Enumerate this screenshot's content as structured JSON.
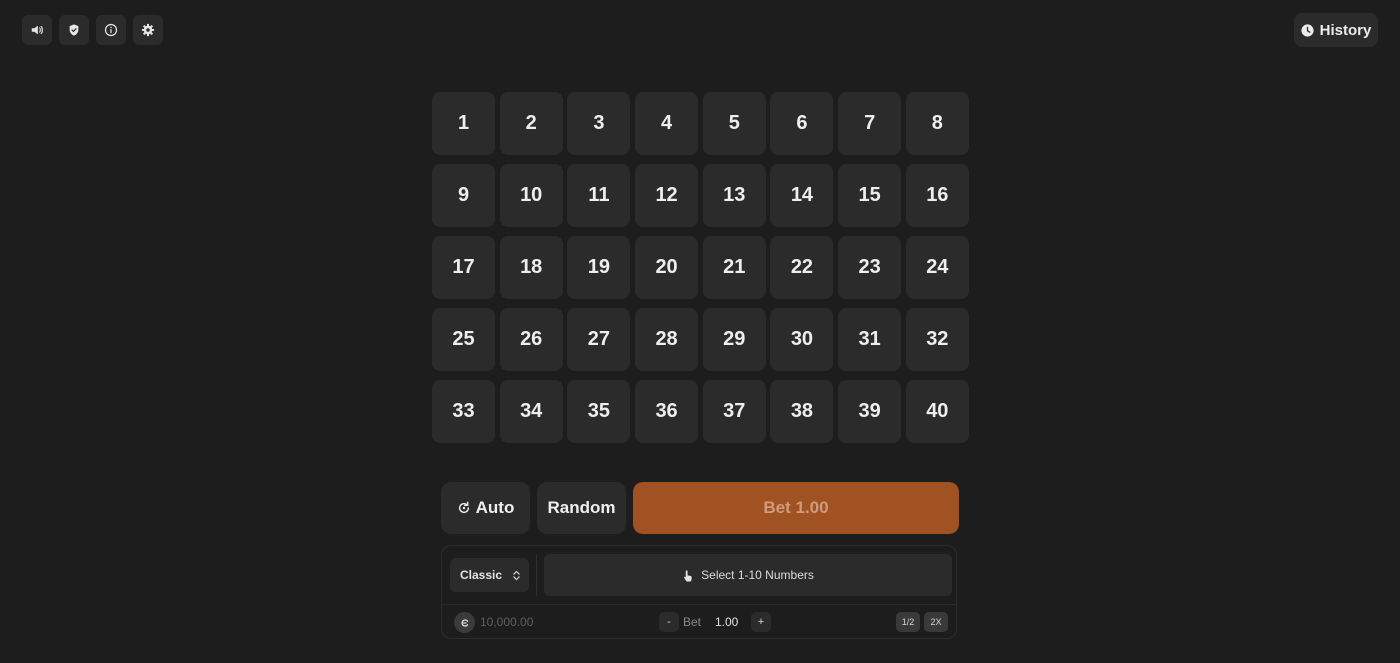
{
  "top_bar": {
    "icons": [
      "volume-icon",
      "shield-icon",
      "info-icon",
      "settings-icon"
    ],
    "history_label": "History"
  },
  "grid": {
    "numbers": [
      "1",
      "2",
      "3",
      "4",
      "5",
      "6",
      "7",
      "8",
      "9",
      "10",
      "11",
      "12",
      "13",
      "14",
      "15",
      "16",
      "17",
      "18",
      "19",
      "20",
      "21",
      "22",
      "23",
      "24",
      "25",
      "26",
      "27",
      "28",
      "29",
      "30",
      "31",
      "32",
      "33",
      "34",
      "35",
      "36",
      "37",
      "38",
      "39",
      "40"
    ]
  },
  "actions": {
    "auto_label": "Auto",
    "random_label": "Random",
    "bet_label": "Bet 1.00"
  },
  "panel": {
    "mode": "Classic",
    "hint": "Select 1-10 Numbers",
    "balance": "10,000.00",
    "minus": "-",
    "bet_label": "Bet",
    "bet_amount": "1.00",
    "plus": "+",
    "half": "1/2",
    "double": "2X"
  },
  "colors": {
    "background": "#1d1d1d",
    "tile": "#2b2b2b",
    "bet_button": "#a05223",
    "bet_text": "#cf9c7b"
  }
}
